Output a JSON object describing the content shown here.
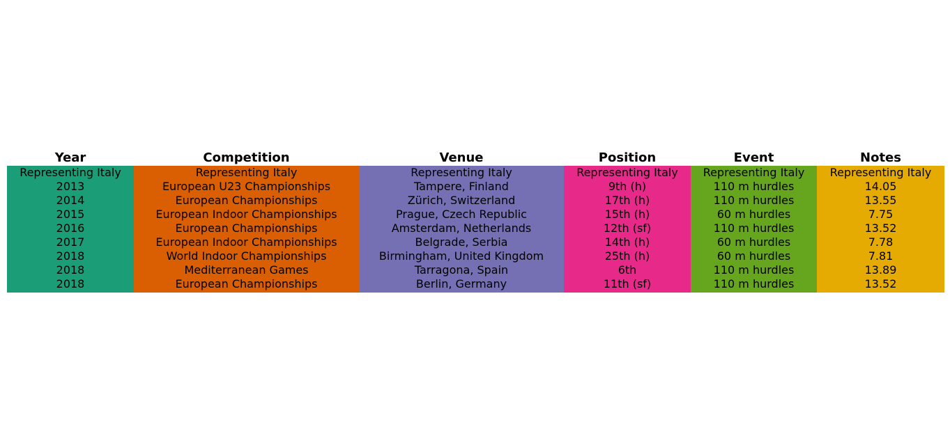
{
  "chart_data": {
    "type": "table",
    "columns": [
      "Year",
      "Competition",
      "Venue",
      "Position",
      "Event",
      "Notes"
    ],
    "column_colors": [
      "#1b9e77",
      "#d95f02",
      "#7570b3",
      "#e7298a",
      "#66a61e",
      "#e6ab02"
    ],
    "rows": [
      [
        "Representing Italy",
        "Representing Italy",
        "Representing Italy",
        "Representing Italy",
        "Representing Italy",
        "Representing Italy"
      ],
      [
        "2013",
        "European U23 Championships",
        "Tampere, Finland",
        "9th (h)",
        "110 m hurdles",
        "14.05"
      ],
      [
        "2014",
        "European Championships",
        "Zürich, Switzerland",
        "17th (h)",
        "110 m hurdles",
        "13.55"
      ],
      [
        "2015",
        "European Indoor Championships",
        "Prague, Czech Republic",
        "15th (h)",
        "60 m hurdles",
        "7.75"
      ],
      [
        "2016",
        "European Championships",
        "Amsterdam, Netherlands",
        "12th (sf)",
        "110 m hurdles",
        "13.52"
      ],
      [
        "2017",
        "European Indoor Championships",
        "Belgrade, Serbia",
        "14th (h)",
        "60 m hurdles",
        "7.78"
      ],
      [
        "2018",
        "World Indoor Championships",
        "Birmingham, United Kingdom",
        "25th (h)",
        "60 m hurdles",
        "7.81"
      ],
      [
        "2018",
        "Mediterranean Games",
        "Tarragona, Spain",
        "6th",
        "110 m hurdles",
        "13.89"
      ],
      [
        "2018",
        "European Championships",
        "Berlin, Germany",
        "11th (sf)",
        "110 m hurdles",
        "13.52"
      ]
    ]
  }
}
